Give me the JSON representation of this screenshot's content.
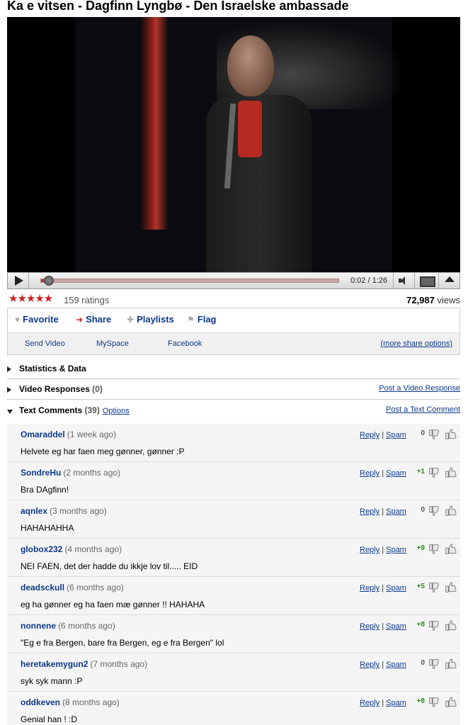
{
  "video": {
    "title": "Ka e vitsen - Dagfinn Lyngbø - Den Israelske ambassade",
    "time": "0:02 / 1:26",
    "progress": 0.0233
  },
  "stats": {
    "stars": "★★★★★",
    "ratings": "159 ratings",
    "views_number": "72,987",
    "views_label": "views"
  },
  "actions": {
    "favorite": "Favorite",
    "share": "Share",
    "playlists": "Playlists",
    "flag": "Flag"
  },
  "share": {
    "send_video": "Send Video",
    "myspace": "MySpace",
    "facebook": "Facebook",
    "more": "(more share options)"
  },
  "sections": {
    "statistics": "Statistics & Data",
    "video_responses": "Video Responses",
    "video_responses_count": "(0)",
    "post_video_response": "Post a Video Response",
    "text_comments": "Text Comments",
    "text_comments_count": "(39)",
    "options": "Options",
    "post_text_comment": "Post a Text Comment"
  },
  "comment_links": {
    "reply": "Reply",
    "sep": "|",
    "spam": "Spam"
  },
  "comments": [
    {
      "author": "Omaraddel",
      "age": "(1 week ago)",
      "text": "Helvete eg har faen meg gønner, gønner :P",
      "score": "0"
    },
    {
      "author": "SondreHu",
      "age": "(2 months ago)",
      "text": "Bra DAgfinn!",
      "score": "+1"
    },
    {
      "author": "aqnlex",
      "age": "(3 months ago)",
      "text": "HAHAHAHHA",
      "score": "0"
    },
    {
      "author": "globox232",
      "age": "(4 months ago)",
      "text": "NEI FAEN, det der hadde du ikkje lov til..... EID",
      "score": "+9"
    },
    {
      "author": "deadsckull",
      "age": "(6 months ago)",
      "text": "eg ha gønner eg ha faen mæ gønner !! HAHAHA",
      "score": "+5"
    },
    {
      "author": "nonnene",
      "age": "(6 months ago)",
      "text": "\"Eg e fra Bergen, bare fra Bergen, eg e fra Bergen\" lol",
      "score": "+8"
    },
    {
      "author": "heretakemygun2",
      "age": "(7 months ago)",
      "text": "syk syk mann :P",
      "score": "0"
    },
    {
      "author": "oddkeven",
      "age": "(8 months ago)",
      "text": "Genial han ! :D",
      "score": "+8"
    }
  ],
  "colors": {
    "star": "#d21f1f",
    "link": "#0d3a8a",
    "positive": "#2a8a1a"
  }
}
